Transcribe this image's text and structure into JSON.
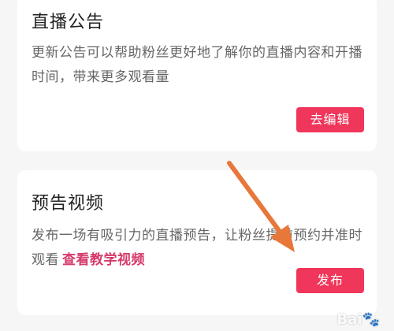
{
  "announcement_card": {
    "title": "直播公告",
    "description": "更新公告可以帮助粉丝更好地了解你的直播内容和开播时间，带来更多观看量",
    "button_label": "去编辑"
  },
  "preview_card": {
    "title": "预告视频",
    "description": "发布一场有吸引力的直播预告，让粉丝提前预约并准时观看",
    "link_label": "查看教学视频",
    "button_label": "发布"
  },
  "colors": {
    "accent": "#f0365a",
    "link": "#d63a6a",
    "arrow": "#e8773a"
  },
  "watermark": {
    "icon": "baidu-paw-icon"
  }
}
